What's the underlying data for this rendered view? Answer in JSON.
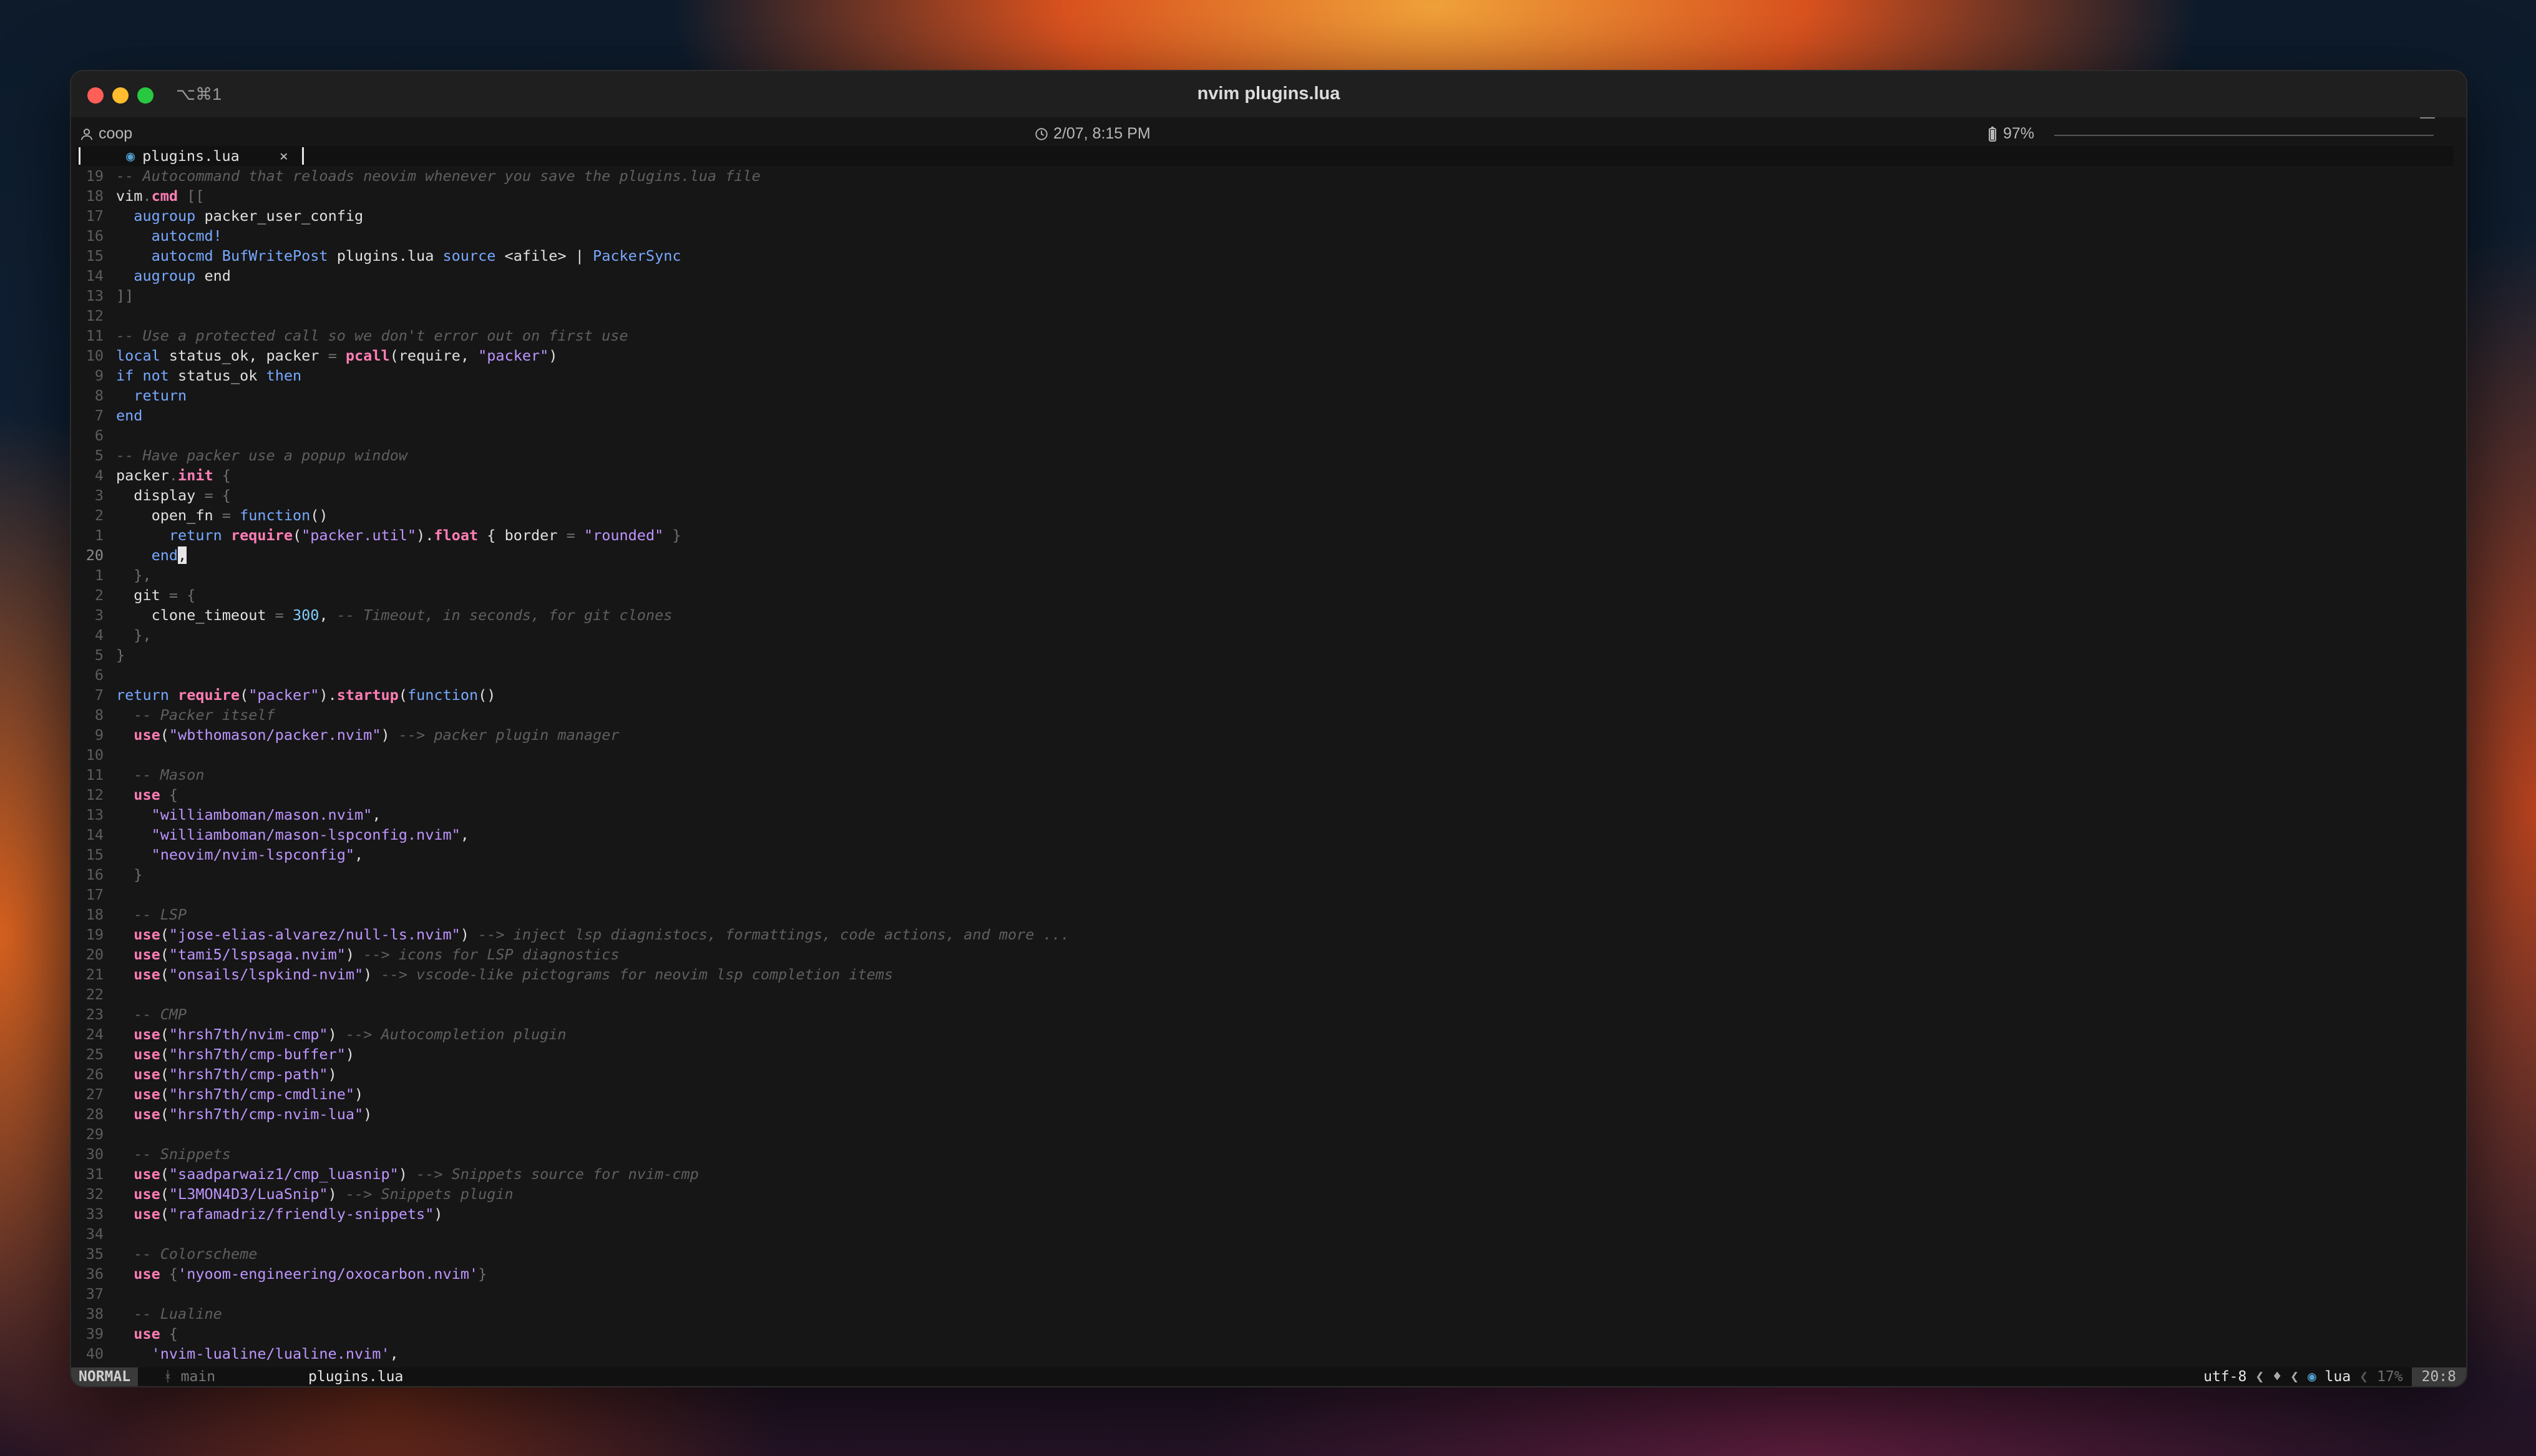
{
  "window": {
    "shortcut": "⌥⌘1",
    "title": "nvim plugins.lua",
    "user": "coop",
    "datetime": "2/07, 8:15 PM",
    "battery": "97%"
  },
  "tab": {
    "filename": "plugins.lua",
    "close": "×"
  },
  "statusline": {
    "mode": "NORMAL",
    "branch_glyph": "ᚼ",
    "branch": "main",
    "file": "plugins.lua",
    "encoding": "utf-8",
    "filetype": "lua",
    "percent": "17%",
    "position": "20:8"
  },
  "colors": {
    "comment": "#5f5f5f",
    "keyword": "#78a9ff",
    "string": "#be95ff",
    "function": "#ff7eb6",
    "number": "#82cfff",
    "punct": "#6f6f6f",
    "text": "#e0e0e0"
  },
  "editor_lines": [
    {
      "n": "19",
      "segs": [
        [
          "-- Autocommand that reloads neovim whenever you save the plugins.lua file",
          "c"
        ]
      ]
    },
    {
      "n": "18",
      "segs": [
        [
          "vim",
          "t"
        ],
        [
          ".",
          "p"
        ],
        [
          "cmd",
          "f"
        ],
        [
          " [[",
          "p"
        ]
      ]
    },
    {
      "n": "17",
      "segs": [
        [
          "  ",
          "t"
        ],
        [
          "augroup",
          "k"
        ],
        [
          " packer_user_config",
          "t"
        ]
      ]
    },
    {
      "n": "16",
      "segs": [
        [
          "    ",
          "t"
        ],
        [
          "autocmd!",
          "k"
        ]
      ]
    },
    {
      "n": "15",
      "segs": [
        [
          "    ",
          "t"
        ],
        [
          "autocmd",
          "k"
        ],
        [
          " ",
          "t"
        ],
        [
          "BufWritePost",
          "k"
        ],
        [
          " plugins.lua ",
          "t"
        ],
        [
          "source",
          "k"
        ],
        [
          " <afile> | ",
          "t"
        ],
        [
          "PackerSync",
          "k"
        ]
      ]
    },
    {
      "n": "14",
      "segs": [
        [
          "  ",
          "t"
        ],
        [
          "augroup",
          "k"
        ],
        [
          " end",
          "t"
        ]
      ]
    },
    {
      "n": "13",
      "segs": [
        [
          "]]",
          "p"
        ]
      ]
    },
    {
      "n": "12",
      "segs": []
    },
    {
      "n": "11",
      "segs": [
        [
          "-- Use a protected call so we don't error out on first use",
          "c"
        ]
      ]
    },
    {
      "n": "10",
      "segs": [
        [
          "local",
          "k"
        ],
        [
          " status_ok, packer ",
          "t"
        ],
        [
          "=",
          "p"
        ],
        [
          " ",
          "t"
        ],
        [
          "pcall",
          "f"
        ],
        [
          "(require, ",
          "t"
        ],
        [
          "\"packer\"",
          "s"
        ],
        [
          ")",
          "t"
        ]
      ]
    },
    {
      "n": "9",
      "segs": [
        [
          "if",
          "k"
        ],
        [
          " ",
          "t"
        ],
        [
          "not",
          "k"
        ],
        [
          " status_ok ",
          "t"
        ],
        [
          "then",
          "k"
        ]
      ]
    },
    {
      "n": "8",
      "segs": [
        [
          "  ",
          "t"
        ],
        [
          "return",
          "k"
        ]
      ]
    },
    {
      "n": "7",
      "segs": [
        [
          "end",
          "k"
        ]
      ]
    },
    {
      "n": "6",
      "segs": []
    },
    {
      "n": "5",
      "segs": [
        [
          "-- Have packer use a popup window",
          "c"
        ]
      ]
    },
    {
      "n": "4",
      "segs": [
        [
          "packer",
          "t"
        ],
        [
          ".",
          "p"
        ],
        [
          "init",
          "f"
        ],
        [
          " {",
          "p"
        ]
      ]
    },
    {
      "n": "3",
      "segs": [
        [
          "  display ",
          "t"
        ],
        [
          "=",
          "p"
        ],
        [
          " {",
          "p"
        ]
      ]
    },
    {
      "n": "2",
      "segs": [
        [
          "    open_fn ",
          "t"
        ],
        [
          "=",
          "p"
        ],
        [
          " ",
          "t"
        ],
        [
          "function",
          "k"
        ],
        [
          "()",
          "t"
        ]
      ]
    },
    {
      "n": "1",
      "segs": [
        [
          "      ",
          "t"
        ],
        [
          "return",
          "k"
        ],
        [
          " ",
          "t"
        ],
        [
          "require",
          "f"
        ],
        [
          "(",
          "t"
        ],
        [
          "\"packer.util\"",
          "s"
        ],
        [
          ").",
          "t"
        ],
        [
          "float",
          "f"
        ],
        [
          " { border ",
          "t"
        ],
        [
          "=",
          "p"
        ],
        [
          " ",
          "t"
        ],
        [
          "\"rounded\"",
          "s"
        ],
        [
          " }",
          "p"
        ]
      ]
    },
    {
      "n": "20",
      "cur": true,
      "segs": [
        [
          "    ",
          "t"
        ],
        [
          "end",
          "k"
        ],
        [
          ",",
          "cur"
        ]
      ]
    },
    {
      "n": "1",
      "segs": [
        [
          "  },",
          "p"
        ]
      ]
    },
    {
      "n": "2",
      "segs": [
        [
          "  git ",
          "t"
        ],
        [
          "=",
          "p"
        ],
        [
          " {",
          "p"
        ]
      ]
    },
    {
      "n": "3",
      "segs": [
        [
          "    clone_timeout ",
          "t"
        ],
        [
          "=",
          "p"
        ],
        [
          " ",
          "t"
        ],
        [
          "300",
          "n"
        ],
        [
          ", ",
          "t"
        ],
        [
          "-- Timeout, in seconds, for git clones",
          "c"
        ]
      ]
    },
    {
      "n": "4",
      "segs": [
        [
          "  },",
          "p"
        ]
      ]
    },
    {
      "n": "5",
      "segs": [
        [
          "}",
          "p"
        ]
      ]
    },
    {
      "n": "6",
      "segs": []
    },
    {
      "n": "7",
      "segs": [
        [
          "return",
          "k"
        ],
        [
          " ",
          "t"
        ],
        [
          "require",
          "f"
        ],
        [
          "(",
          "t"
        ],
        [
          "\"packer\"",
          "s"
        ],
        [
          ").",
          "t"
        ],
        [
          "startup",
          "f"
        ],
        [
          "(",
          "t"
        ],
        [
          "function",
          "k"
        ],
        [
          "()",
          "t"
        ]
      ]
    },
    {
      "n": "8",
      "segs": [
        [
          "  ",
          "t"
        ],
        [
          "-- Packer itself",
          "c"
        ]
      ]
    },
    {
      "n": "9",
      "segs": [
        [
          "  ",
          "t"
        ],
        [
          "use",
          "f"
        ],
        [
          "(",
          "t"
        ],
        [
          "\"wbthomason/packer.nvim\"",
          "s"
        ],
        [
          ") ",
          "t"
        ],
        [
          "--> packer plugin manager",
          "c"
        ]
      ]
    },
    {
      "n": "10",
      "segs": []
    },
    {
      "n": "11",
      "segs": [
        [
          "  ",
          "t"
        ],
        [
          "-- Mason",
          "c"
        ]
      ]
    },
    {
      "n": "12",
      "segs": [
        [
          "  ",
          "t"
        ],
        [
          "use",
          "f"
        ],
        [
          " {",
          "p"
        ]
      ]
    },
    {
      "n": "13",
      "segs": [
        [
          "    ",
          "t"
        ],
        [
          "\"williamboman/mason.nvim\"",
          "s"
        ],
        [
          ",",
          "t"
        ]
      ]
    },
    {
      "n": "14",
      "segs": [
        [
          "    ",
          "t"
        ],
        [
          "\"williamboman/mason-lspconfig.nvim\"",
          "s"
        ],
        [
          ",",
          "t"
        ]
      ]
    },
    {
      "n": "15",
      "segs": [
        [
          "    ",
          "t"
        ],
        [
          "\"neovim/nvim-lspconfig\"",
          "s"
        ],
        [
          ",",
          "t"
        ]
      ]
    },
    {
      "n": "16",
      "segs": [
        [
          "  }",
          "p"
        ]
      ]
    },
    {
      "n": "17",
      "segs": []
    },
    {
      "n": "18",
      "segs": [
        [
          "  ",
          "t"
        ],
        [
          "-- LSP",
          "c"
        ]
      ]
    },
    {
      "n": "19",
      "segs": [
        [
          "  ",
          "t"
        ],
        [
          "use",
          "f"
        ],
        [
          "(",
          "t"
        ],
        [
          "\"jose-elias-alvarez/null-ls.nvim\"",
          "s"
        ],
        [
          ") ",
          "t"
        ],
        [
          "--> inject lsp diagnistocs, formattings, code actions, and more ...",
          "c"
        ]
      ]
    },
    {
      "n": "20",
      "segs": [
        [
          "  ",
          "t"
        ],
        [
          "use",
          "f"
        ],
        [
          "(",
          "t"
        ],
        [
          "\"tami5/lspsaga.nvim\"",
          "s"
        ],
        [
          ") ",
          "t"
        ],
        [
          "--> icons for LSP diagnostics",
          "c"
        ]
      ]
    },
    {
      "n": "21",
      "segs": [
        [
          "  ",
          "t"
        ],
        [
          "use",
          "f"
        ],
        [
          "(",
          "t"
        ],
        [
          "\"onsails/lspkind-nvim\"",
          "s"
        ],
        [
          ") ",
          "t"
        ],
        [
          "--> vscode-like pictograms for neovim lsp completion items",
          "c"
        ]
      ]
    },
    {
      "n": "22",
      "segs": []
    },
    {
      "n": "23",
      "segs": [
        [
          "  ",
          "t"
        ],
        [
          "-- CMP",
          "c"
        ]
      ]
    },
    {
      "n": "24",
      "segs": [
        [
          "  ",
          "t"
        ],
        [
          "use",
          "f"
        ],
        [
          "(",
          "t"
        ],
        [
          "\"hrsh7th/nvim-cmp\"",
          "s"
        ],
        [
          ") ",
          "t"
        ],
        [
          "--> Autocompletion plugin",
          "c"
        ]
      ]
    },
    {
      "n": "25",
      "segs": [
        [
          "  ",
          "t"
        ],
        [
          "use",
          "f"
        ],
        [
          "(",
          "t"
        ],
        [
          "\"hrsh7th/cmp-buffer\"",
          "s"
        ],
        [
          ")",
          "t"
        ]
      ]
    },
    {
      "n": "26",
      "segs": [
        [
          "  ",
          "t"
        ],
        [
          "use",
          "f"
        ],
        [
          "(",
          "t"
        ],
        [
          "\"hrsh7th/cmp-path\"",
          "s"
        ],
        [
          ")",
          "t"
        ]
      ]
    },
    {
      "n": "27",
      "segs": [
        [
          "  ",
          "t"
        ],
        [
          "use",
          "f"
        ],
        [
          "(",
          "t"
        ],
        [
          "\"hrsh7th/cmp-cmdline\"",
          "s"
        ],
        [
          ")",
          "t"
        ]
      ]
    },
    {
      "n": "28",
      "segs": [
        [
          "  ",
          "t"
        ],
        [
          "use",
          "f"
        ],
        [
          "(",
          "t"
        ],
        [
          "\"hrsh7th/cmp-nvim-lua\"",
          "s"
        ],
        [
          ")",
          "t"
        ]
      ]
    },
    {
      "n": "29",
      "segs": []
    },
    {
      "n": "30",
      "segs": [
        [
          "  ",
          "t"
        ],
        [
          "-- Snippets",
          "c"
        ]
      ]
    },
    {
      "n": "31",
      "segs": [
        [
          "  ",
          "t"
        ],
        [
          "use",
          "f"
        ],
        [
          "(",
          "t"
        ],
        [
          "\"saadparwaiz1/cmp_luasnip\"",
          "s"
        ],
        [
          ") ",
          "t"
        ],
        [
          "--> Snippets source for nvim-cmp",
          "c"
        ]
      ]
    },
    {
      "n": "32",
      "segs": [
        [
          "  ",
          "t"
        ],
        [
          "use",
          "f"
        ],
        [
          "(",
          "t"
        ],
        [
          "\"L3MON4D3/LuaSnip\"",
          "s"
        ],
        [
          ") ",
          "t"
        ],
        [
          "--> Snippets plugin",
          "c"
        ]
      ]
    },
    {
      "n": "33",
      "segs": [
        [
          "  ",
          "t"
        ],
        [
          "use",
          "f"
        ],
        [
          "(",
          "t"
        ],
        [
          "\"rafamadriz/friendly-snippets\"",
          "s"
        ],
        [
          ")",
          "t"
        ]
      ]
    },
    {
      "n": "34",
      "segs": []
    },
    {
      "n": "35",
      "segs": [
        [
          "  ",
          "t"
        ],
        [
          "-- Colorscheme",
          "c"
        ]
      ]
    },
    {
      "n": "36",
      "segs": [
        [
          "  ",
          "t"
        ],
        [
          "use",
          "f"
        ],
        [
          " {",
          "p"
        ],
        [
          "'nyoom-engineering/oxocarbon.nvim'",
          "s"
        ],
        [
          "}",
          "p"
        ]
      ]
    },
    {
      "n": "37",
      "segs": []
    },
    {
      "n": "38",
      "segs": [
        [
          "  ",
          "t"
        ],
        [
          "-- Lualine",
          "c"
        ]
      ]
    },
    {
      "n": "39",
      "segs": [
        [
          "  ",
          "t"
        ],
        [
          "use",
          "f"
        ],
        [
          " {",
          "p"
        ]
      ]
    },
    {
      "n": "40",
      "segs": [
        [
          "    ",
          "t"
        ],
        [
          "'nvim-lualine/lualine.nvim'",
          "s"
        ],
        [
          ",",
          "t"
        ]
      ]
    }
  ]
}
